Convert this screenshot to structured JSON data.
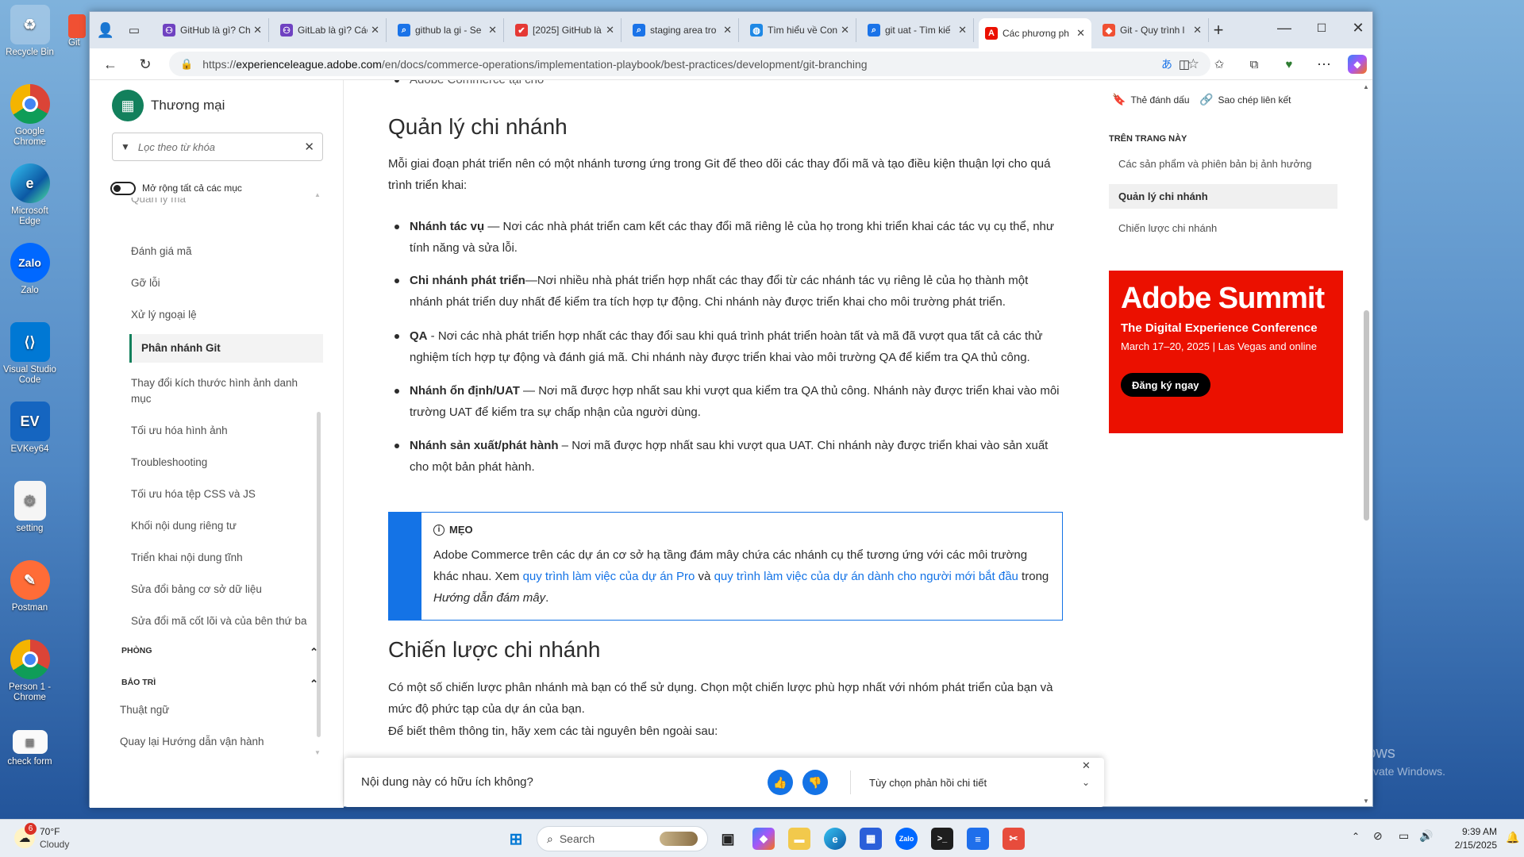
{
  "desktop": {
    "icons": [
      {
        "label": "Recycle Bin",
        "icon": "recycle-bin-icon"
      },
      {
        "label": "Google Chrome",
        "icon": "chrome-icon"
      },
      {
        "label": "Microsoft Edge",
        "icon": "edge-icon"
      },
      {
        "label": "Zalo",
        "icon": "zalo-icon"
      },
      {
        "label": "Visual Studio Code",
        "icon": "vscode-icon"
      },
      {
        "label": "EVKey64",
        "icon": "evkey-icon"
      },
      {
        "label": "setting",
        "icon": "file-icon"
      },
      {
        "label": "Postman",
        "icon": "postman-icon"
      },
      {
        "label": "Person 1 - Chrome",
        "icon": "chrome-icon"
      },
      {
        "label": "check form",
        "icon": "file-icon"
      }
    ],
    "partial_icon_label": "Git",
    "watermark": {
      "title": "Activate Windows",
      "subtitle": "Go to Settings to activate Windows."
    }
  },
  "browser": {
    "tabs": [
      {
        "title": "GitHub là gì? Ch",
        "icon": "github-icon",
        "color": "#6f42c1"
      },
      {
        "title": "GitLab là gì? Các",
        "icon": "gitlab-icon",
        "color": "#6f42c1"
      },
      {
        "title": "github la gi - Se",
        "icon": "search-icon",
        "color": "#1a73e8"
      },
      {
        "title": "[2025] GitHub là",
        "icon": "checkmark-icon",
        "color": "#e53935"
      },
      {
        "title": "staging area tro",
        "icon": "search-icon",
        "color": "#1a73e8"
      },
      {
        "title": "Tìm hiểu về Con",
        "icon": "globe-icon",
        "color": "#1e88e5"
      },
      {
        "title": "git uat - Tìm kiế",
        "icon": "search-icon",
        "color": "#1a73e8"
      },
      {
        "title": "Các phương ph",
        "icon": "adobe-icon",
        "color": "#eb1000",
        "active": true
      },
      {
        "title": "Git - Quy trình l",
        "icon": "git-icon",
        "color": "#f05033"
      }
    ],
    "url_prefix": "https://",
    "url_host": "experienceleague.adobe.com",
    "url_path": "/en/docs/commerce-operations/implementation-playbook/best-practices/development/git-branching"
  },
  "sidebar": {
    "brand": "Thương mại",
    "filter_placeholder": "Lọc theo từ khóa",
    "expand_all": "Mở rộng tất cả các mục",
    "partial_top": "Quản lý mã",
    "items": [
      "Đánh giá mã",
      "Gỡ lỗi",
      "Xử lý ngoại lệ",
      "Phân nhánh Git",
      "Thay đổi kích thước hình ảnh danh mục",
      "Tối ưu hóa hình ảnh",
      "Troubleshooting",
      "Tối ưu hóa tệp CSS và JS",
      "Khối nội dung riêng tư",
      "Triển khai nội dung tĩnh",
      "Sửa đổi bảng cơ sở dữ liệu",
      "Sửa đổi mã cốt lõi và của bên thứ ba"
    ],
    "active_index": 3,
    "sections": [
      "PHÒNG",
      "BẢO TRÌ"
    ],
    "bottom_links": [
      "Thuật ngữ",
      "Quay lại Hướng dẫn vận hành"
    ]
  },
  "article": {
    "partial_top": "Adobe Commerce tại chỗ",
    "h_manage": "Quản lý chi nhánh",
    "intro": "Mỗi giai đoạn phát triển nên có một nhánh tương ứng trong Git để theo dõi các thay đổi mã và tạo điều kiện thuận lợi cho quá trình triển khai:",
    "bullets": [
      {
        "term": "Nhánh tác vụ",
        "text": " — Nơi các nhà phát triển cam kết các thay đổi mã riêng lẻ của họ trong khi triển khai các tác vụ cụ thể, như tính năng và sửa lỗi."
      },
      {
        "term": "Chi nhánh phát triển",
        "text": "—Nơi nhiều nhà phát triển hợp nhất các thay đổi từ các nhánh tác vụ riêng lẻ của họ thành một nhánh phát triển duy nhất để kiểm tra tích hợp tự động. Chi nhánh này được triển khai cho môi trường phát triển."
      },
      {
        "term": "QA",
        "text": " - Nơi các nhà phát triển hợp nhất các thay đổi sau khi quá trình phát triển hoàn tất và mã đã vượt qua tất cả các thử nghiệm tích hợp tự động và đánh giá mã. Chi nhánh này được triển khai vào môi trường QA để kiểm tra QA thủ công."
      },
      {
        "term": "Nhánh ổn định/UAT",
        "text": " — Nơi mã được hợp nhất sau khi vượt qua kiểm tra QA thủ công. Nhánh này được triển khai vào môi trường UAT để kiểm tra sự chấp nhận của người dùng."
      },
      {
        "term": "Nhánh sản xuất/phát hành",
        "text": " – Nơi mã được hợp nhất sau khi vượt qua UAT. Chi nhánh này được triển khai vào sản xuất cho một bản phát hành."
      }
    ],
    "tip": {
      "label": "MẸO",
      "text1": "Adobe Commerce trên các dự án cơ sở hạ tầng đám mây chứa các nhánh cụ thể tương ứng với các môi trường khác nhau. Xem ",
      "link1": "quy trình làm việc của dự án Pro",
      "and": " và ",
      "link2": "quy trình làm việc của dự án dành cho người mới bắt đầu",
      "text2": " trong ",
      "italic": "Hướng dẫn đám mây",
      "end": "."
    },
    "h_strategy": "Chiến lược chi nhánh",
    "strategy_text": "Có một số chiến lược phân nhánh mà bạn có thể sử dụng. Chọn một chiến lược phù hợp nhất với nhóm phát triển của bạn và mức độ phức tạp của dự án của bạn.",
    "more_info": "Để biết thêm thông tin, hãy xem các tài nguyên bên ngoài sau:"
  },
  "feedback": {
    "question": "Nội dung này có hữu ích không?",
    "detail": "Tùy chọn phản hồi chi tiết"
  },
  "rightcol": {
    "bookmark": "Thẻ đánh dấu",
    "copy_link": "Sao chép liên kết",
    "on_page": "TRÊN TRANG NÀY",
    "toc": [
      "Các sản phẩm và phiên bản bị ảnh hưởng",
      "Quản lý chi nhánh",
      "Chiến lược chi nhánh"
    ],
    "toc_active": 1,
    "ad": {
      "title": "Adobe Summit",
      "subtitle": "The Digital Experience Conference",
      "date": "March 17–20, 2025 | Las Vegas and online",
      "cta": "Đăng ký ngay",
      "color": "#eb1000"
    }
  },
  "taskbar": {
    "weather_temp": "70°F",
    "weather_desc": "Cloudy",
    "weather_badge": "6",
    "search": "Search",
    "time": "9:39 AM",
    "date": "2/15/2025"
  }
}
